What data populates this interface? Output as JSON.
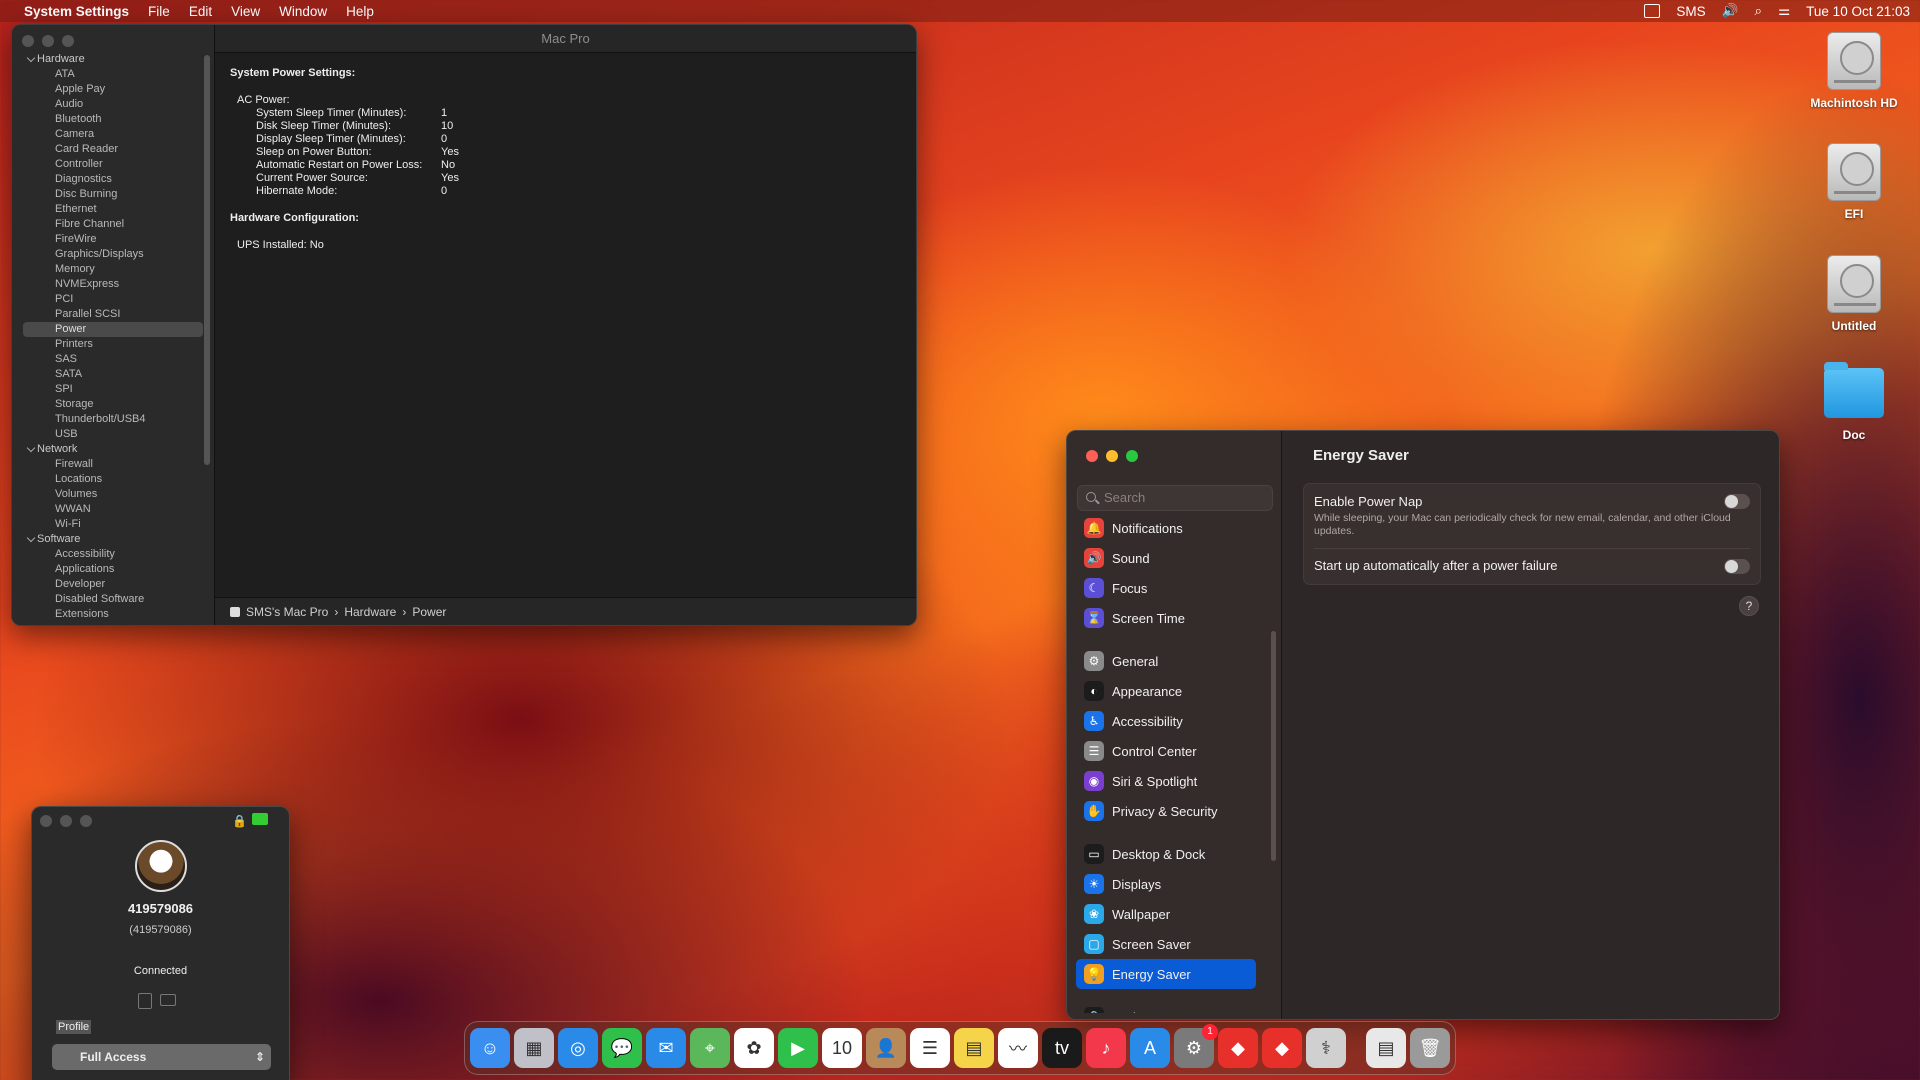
{
  "menubar": {
    "app": "System Settings",
    "items": [
      "File",
      "Edit",
      "View",
      "Window",
      "Help"
    ],
    "user": "SMS",
    "datetime": "Tue 10 Oct  21:03"
  },
  "sysinfo": {
    "title": "Mac Pro",
    "tree": [
      {
        "group": "Hardware",
        "items": [
          "ATA",
          "Apple Pay",
          "Audio",
          "Bluetooth",
          "Camera",
          "Card Reader",
          "Controller",
          "Diagnostics",
          "Disc Burning",
          "Ethernet",
          "Fibre Channel",
          "FireWire",
          "Graphics/Displays",
          "Memory",
          "NVMExpress",
          "PCI",
          "Parallel SCSI",
          "Power",
          "Printers",
          "SAS",
          "SATA",
          "SPI",
          "Storage",
          "Thunderbolt/USB4",
          "USB"
        ]
      },
      {
        "group": "Network",
        "items": [
          "Firewall",
          "Locations",
          "Volumes",
          "WWAN",
          "Wi-Fi"
        ]
      },
      {
        "group": "Software",
        "items": [
          "Accessibility",
          "Applications",
          "Developer",
          "Disabled Software",
          "Extensions"
        ]
      }
    ],
    "selected": "Power",
    "heading1": "System Power Settings:",
    "ac_label": "AC Power:",
    "ac": [
      [
        "System Sleep Timer (Minutes):",
        "1"
      ],
      [
        "Disk Sleep Timer (Minutes):",
        "10"
      ],
      [
        "Display Sleep Timer (Minutes):",
        "0"
      ],
      [
        "Sleep on Power Button:",
        "Yes"
      ],
      [
        "Automatic Restart on Power Loss:",
        "No"
      ],
      [
        "Current Power Source:",
        "Yes"
      ],
      [
        "Hibernate Mode:",
        "0"
      ]
    ],
    "heading2": "Hardware Configuration:",
    "ups": "UPS Installed:  No",
    "path": [
      "SMS's Mac Pro",
      "Hardware",
      "Power"
    ]
  },
  "settings": {
    "search_placeholder": "Search",
    "nav": [
      {
        "label": "Notifications",
        "color": "#e8433a",
        "glyph": "🔔"
      },
      {
        "label": "Sound",
        "color": "#e8433a",
        "glyph": "🔊"
      },
      {
        "label": "Focus",
        "color": "#5b4fd6",
        "glyph": "☾"
      },
      {
        "label": "Screen Time",
        "color": "#5b4fd6",
        "glyph": "⌛"
      },
      {
        "gap": true
      },
      {
        "label": "General",
        "color": "#8a8a8a",
        "glyph": "⚙"
      },
      {
        "label": "Appearance",
        "color": "#1c1c1c",
        "glyph": "◐"
      },
      {
        "label": "Accessibility",
        "color": "#1a73e8",
        "glyph": "♿"
      },
      {
        "label": "Control Center",
        "color": "#8a8a8a",
        "glyph": "☰"
      },
      {
        "label": "Siri & Spotlight",
        "color": "#7a3fd0",
        "glyph": "◉"
      },
      {
        "label": "Privacy & Security",
        "color": "#1a73e8",
        "glyph": "✋"
      },
      {
        "gap": true
      },
      {
        "label": "Desktop & Dock",
        "color": "#1c1c1c",
        "glyph": "▭"
      },
      {
        "label": "Displays",
        "color": "#1a73e8",
        "glyph": "☀"
      },
      {
        "label": "Wallpaper",
        "color": "#2aa8e8",
        "glyph": "❀"
      },
      {
        "label": "Screen Saver",
        "color": "#2aa8e8",
        "glyph": "▢"
      },
      {
        "label": "Energy Saver",
        "color": "#f0a020",
        "glyph": "💡",
        "selected": true
      },
      {
        "gap": true
      },
      {
        "label": "Lock Screen",
        "color": "#1c1c1c",
        "glyph": "🔒"
      }
    ],
    "pane_title": "Energy Saver",
    "power_nap_label": "Enable Power Nap",
    "power_nap_desc": "While sleeping, your Mac can periodically check for new email, calendar, and other iCloud updates.",
    "startup_label": "Start up automatically after a power failure",
    "help": "?"
  },
  "teamviewer": {
    "id": "419579086",
    "sub": "(419579086)",
    "status": "Connected",
    "profile_label": "Profile",
    "access": "Full Access"
  },
  "desktop": [
    {
      "label": "Machintosh HD",
      "type": "drive"
    },
    {
      "label": "EFI",
      "type": "drive"
    },
    {
      "label": "Untitled",
      "type": "drive"
    },
    {
      "label": "Doc",
      "type": "folder"
    }
  ],
  "dock": [
    {
      "name": "finder",
      "color": "#3a8ef0",
      "glyph": "☺"
    },
    {
      "name": "launchpad",
      "color": "#c0c0c8",
      "glyph": "▦"
    },
    {
      "name": "safari",
      "color": "#2a8ae8",
      "glyph": "◎"
    },
    {
      "name": "messages",
      "color": "#2ec04a",
      "glyph": "💬"
    },
    {
      "name": "mail",
      "color": "#2a8ae8",
      "glyph": "✉"
    },
    {
      "name": "maps",
      "color": "#5ab85a",
      "glyph": "⌖"
    },
    {
      "name": "photos",
      "color": "#ffffff",
      "glyph": "✿"
    },
    {
      "name": "facetime",
      "color": "#2ec04a",
      "glyph": "▶"
    },
    {
      "name": "calendar",
      "color": "#ffffff",
      "glyph": "10"
    },
    {
      "name": "contacts",
      "color": "#b88a5a",
      "glyph": "👤"
    },
    {
      "name": "reminders",
      "color": "#ffffff",
      "glyph": "☰"
    },
    {
      "name": "notes",
      "color": "#f5d44a",
      "glyph": "▤"
    },
    {
      "name": "freeform",
      "color": "#ffffff",
      "glyph": "〰"
    },
    {
      "name": "tv",
      "color": "#1a1a1a",
      "glyph": "tv"
    },
    {
      "name": "music",
      "color": "#f2384a",
      "glyph": "♪"
    },
    {
      "name": "app-store",
      "color": "#2a8ae8",
      "glyph": "A"
    },
    {
      "name": "system-settings",
      "color": "#7a7a7a",
      "glyph": "⚙",
      "badge": "1"
    },
    {
      "name": "anydesk",
      "color": "#e8302a",
      "glyph": "◆"
    },
    {
      "name": "anydesk-2",
      "color": "#e8302a",
      "glyph": "◆"
    },
    {
      "name": "system-information",
      "color": "#d0d0d0",
      "glyph": "⚕"
    },
    {
      "sep": true
    },
    {
      "name": "document",
      "color": "#e8e8e8",
      "glyph": "▤"
    },
    {
      "name": "trash",
      "color": "#9a9a9a",
      "glyph": "🗑"
    }
  ]
}
